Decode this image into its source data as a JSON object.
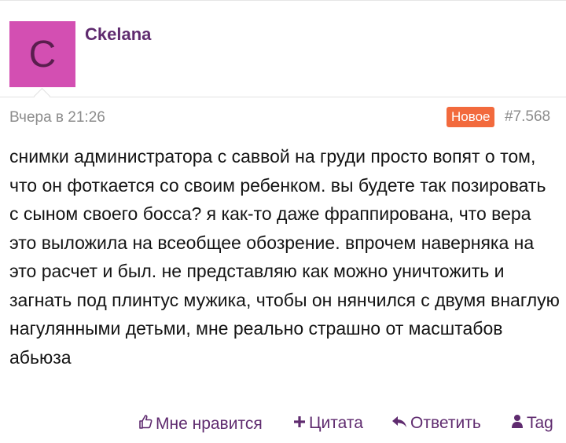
{
  "post": {
    "avatar_letter": "C",
    "avatar_color": "#d34fb2",
    "username": "Ckelana",
    "date": "Вчера в 21:26",
    "badge": "Новое",
    "badge_color": "#f26a3d",
    "post_number": "#7.568",
    "message": "снимки администратора с саввой на груди просто вопят о том, что он фоткается со своим ребенком. вы будете так позировать с сыном своего босса? я как-то даже фраппирована, что вера это выложила на всеобщее обозрение. впрочем наверняка на это расчет и был. не представляю как можно уничтожить и загнать под плинтус мужика, чтобы он нянчился с двумя внаглую нагулянными детьми, мне реально страшно от масштабов абьюза"
  },
  "actions": {
    "like": "Мне нравится",
    "quote": "Цитата",
    "reply": "Ответить",
    "tag": "Tag"
  },
  "colors": {
    "link": "#5f2b6f",
    "muted": "#8c8c8c"
  }
}
